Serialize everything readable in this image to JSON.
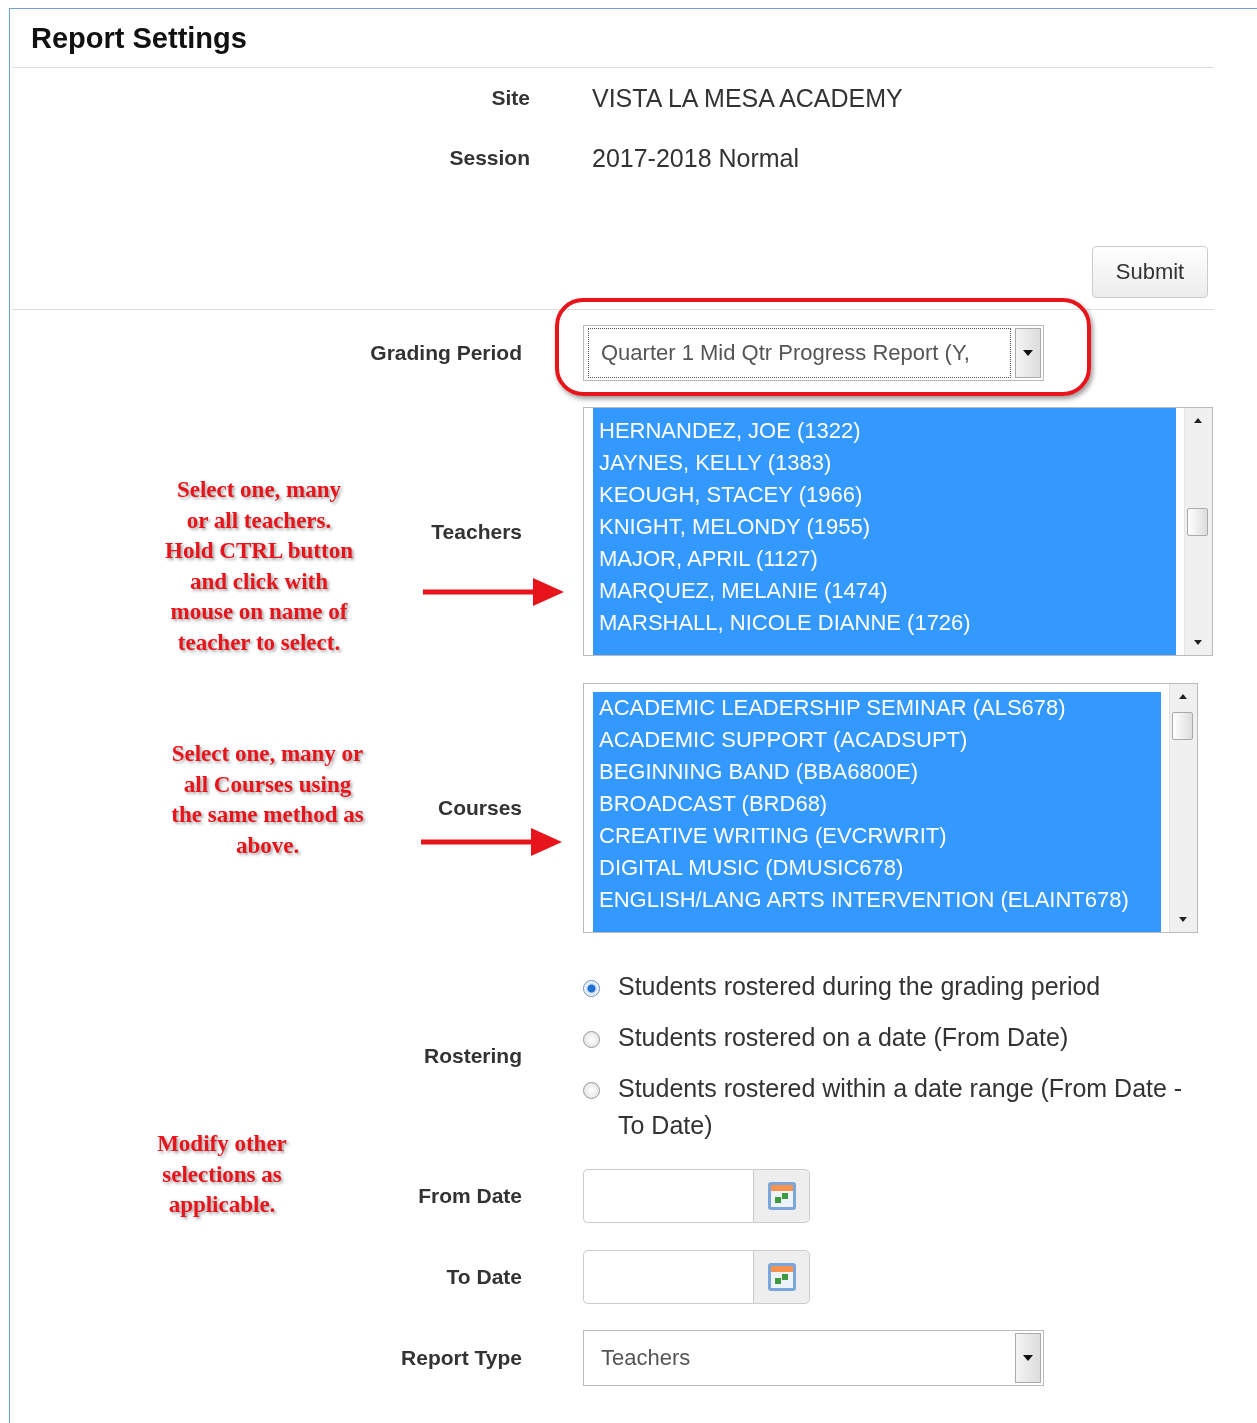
{
  "title": "Report Settings",
  "site": {
    "label": "Site",
    "value": "VISTA LA MESA ACADEMY"
  },
  "session": {
    "label": "Session",
    "value": "2017-2018 Normal"
  },
  "submit_button": "Submit",
  "grading_period": {
    "label": "Grading Period",
    "value": "Quarter 1 Mid Qtr Progress Report (Y,",
    "highlighted": true
  },
  "teachers": {
    "label": "Teachers",
    "items": [
      {
        "text": "HERNANDEZ, JOE (1322)",
        "selected": true
      },
      {
        "text": "JAYNES, KELLY (1383)",
        "selected": true
      },
      {
        "text": "KEOUGH, STACEY (1966)",
        "selected": true
      },
      {
        "text": "KNIGHT, MELONDY (1955)",
        "selected": true
      },
      {
        "text": "MAJOR, APRIL (1127)",
        "selected": true
      },
      {
        "text": "MARQUEZ, MELANIE (1474)",
        "selected": true
      },
      {
        "text": "MARSHALL, NICOLE DIANNE (1726)",
        "selected": true
      }
    ]
  },
  "courses": {
    "label": "Courses",
    "items": [
      {
        "text": "ACADEMIC LEADERSHIP SEMINAR (ALS678)",
        "selected": true
      },
      {
        "text": "ACADEMIC SUPPORT (ACADSUPT)",
        "selected": true
      },
      {
        "text": "BEGINNING BAND (BBA6800E)",
        "selected": true
      },
      {
        "text": "BROADCAST (BRD68)",
        "selected": true
      },
      {
        "text": "CREATIVE WRITING (EVCRWRIT)",
        "selected": true
      },
      {
        "text": "DIGITAL MUSIC (DMUSIC678)",
        "selected": true
      },
      {
        "text": "ENGLISH/LANG ARTS INTERVENTION (ELAINT678)",
        "selected": true
      }
    ]
  },
  "rostering": {
    "label": "Rostering",
    "options": [
      {
        "text": "Students rostered during the grading period",
        "selected": true
      },
      {
        "text": "Students rostered on a date (From Date)",
        "selected": false
      },
      {
        "text": "Students rostered within a date range (From Date - To Date)",
        "selected": false
      }
    ]
  },
  "from_date": {
    "label": "From Date"
  },
  "to_date": {
    "label": "To Date"
  },
  "report_type": {
    "label": "Report Type",
    "value": "Teachers"
  },
  "annotations": [
    {
      "lines": [
        "Select one, many",
        "or all teachers.",
        "Hold CTRL button",
        "and click with",
        "mouse on name of",
        "teacher to select."
      ]
    },
    {
      "lines": [
        "Select one, many or",
        "all Courses using",
        "the same method as",
        "above."
      ]
    },
    {
      "lines": [
        "Modify other",
        "selections as",
        "applicable."
      ]
    }
  ]
}
